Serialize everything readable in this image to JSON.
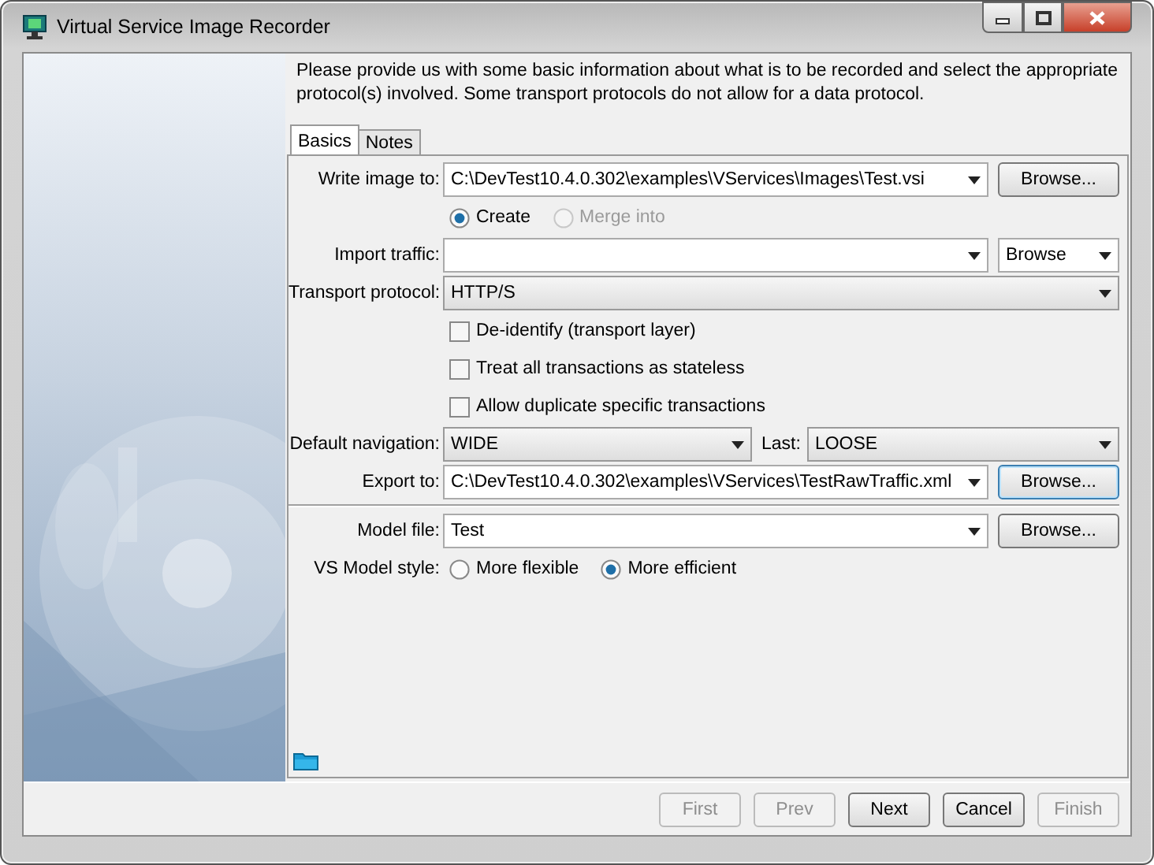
{
  "window": {
    "title": "Virtual Service Image Recorder"
  },
  "instructions": "Please provide us with some basic information about what is to be recorded and select the appropriate protocol(s) involved.  Some transport protocols do not allow for a data protocol.",
  "tabs": [
    {
      "label": "Basics",
      "selected": true
    },
    {
      "label": "Notes",
      "selected": false
    }
  ],
  "form": {
    "rows": [
      {
        "kind": "path",
        "label": "Write image to:",
        "value": "C:\\DevTest10.4.0.302\\examples\\VServices\\Images\\Test.vsi",
        "button": "Browse...",
        "focused": false
      },
      {
        "kind": "radios",
        "options": [
          {
            "label": "Create",
            "selected": true,
            "disabled": false
          },
          {
            "label": "Merge into",
            "selected": false,
            "disabled": true
          }
        ]
      },
      {
        "kind": "import",
        "label": "Import traffic:",
        "browse": "Browse"
      },
      {
        "kind": "select",
        "label": "Transport protocol:",
        "value": "HTTP/S"
      },
      {
        "kind": "check",
        "label": "De-identify (transport layer)",
        "checked": false
      },
      {
        "kind": "check",
        "label": "Treat all transactions as stateless",
        "checked": false
      },
      {
        "kind": "check",
        "label": "Allow duplicate specific transactions",
        "checked": false
      },
      {
        "kind": "pair",
        "label": "Default navigation:",
        "value": "WIDE",
        "label2": "Last:",
        "value2": "LOOSE"
      },
      {
        "kind": "path",
        "label": "Export to:",
        "value": "C:\\DevTest10.4.0.302\\examples\\VServices\\TestRawTraffic.xml",
        "button": "Browse...",
        "focused": true
      },
      {
        "kind": "divider"
      },
      {
        "kind": "path",
        "label": "Model file:",
        "value": "Test",
        "button": "Browse...",
        "focused": false
      },
      {
        "kind": "radios",
        "label": "VS Model style:",
        "options": [
          {
            "label": "More flexible",
            "selected": false,
            "disabled": false
          },
          {
            "label": "More efficient",
            "selected": true,
            "disabled": false
          }
        ]
      }
    ]
  },
  "buttons": [
    {
      "label": "First",
      "disabled": true
    },
    {
      "label": "Prev",
      "disabled": true
    },
    {
      "label": "Next",
      "disabled": false
    },
    {
      "label": "Cancel",
      "disabled": false
    },
    {
      "label": "Finish",
      "disabled": true
    }
  ]
}
